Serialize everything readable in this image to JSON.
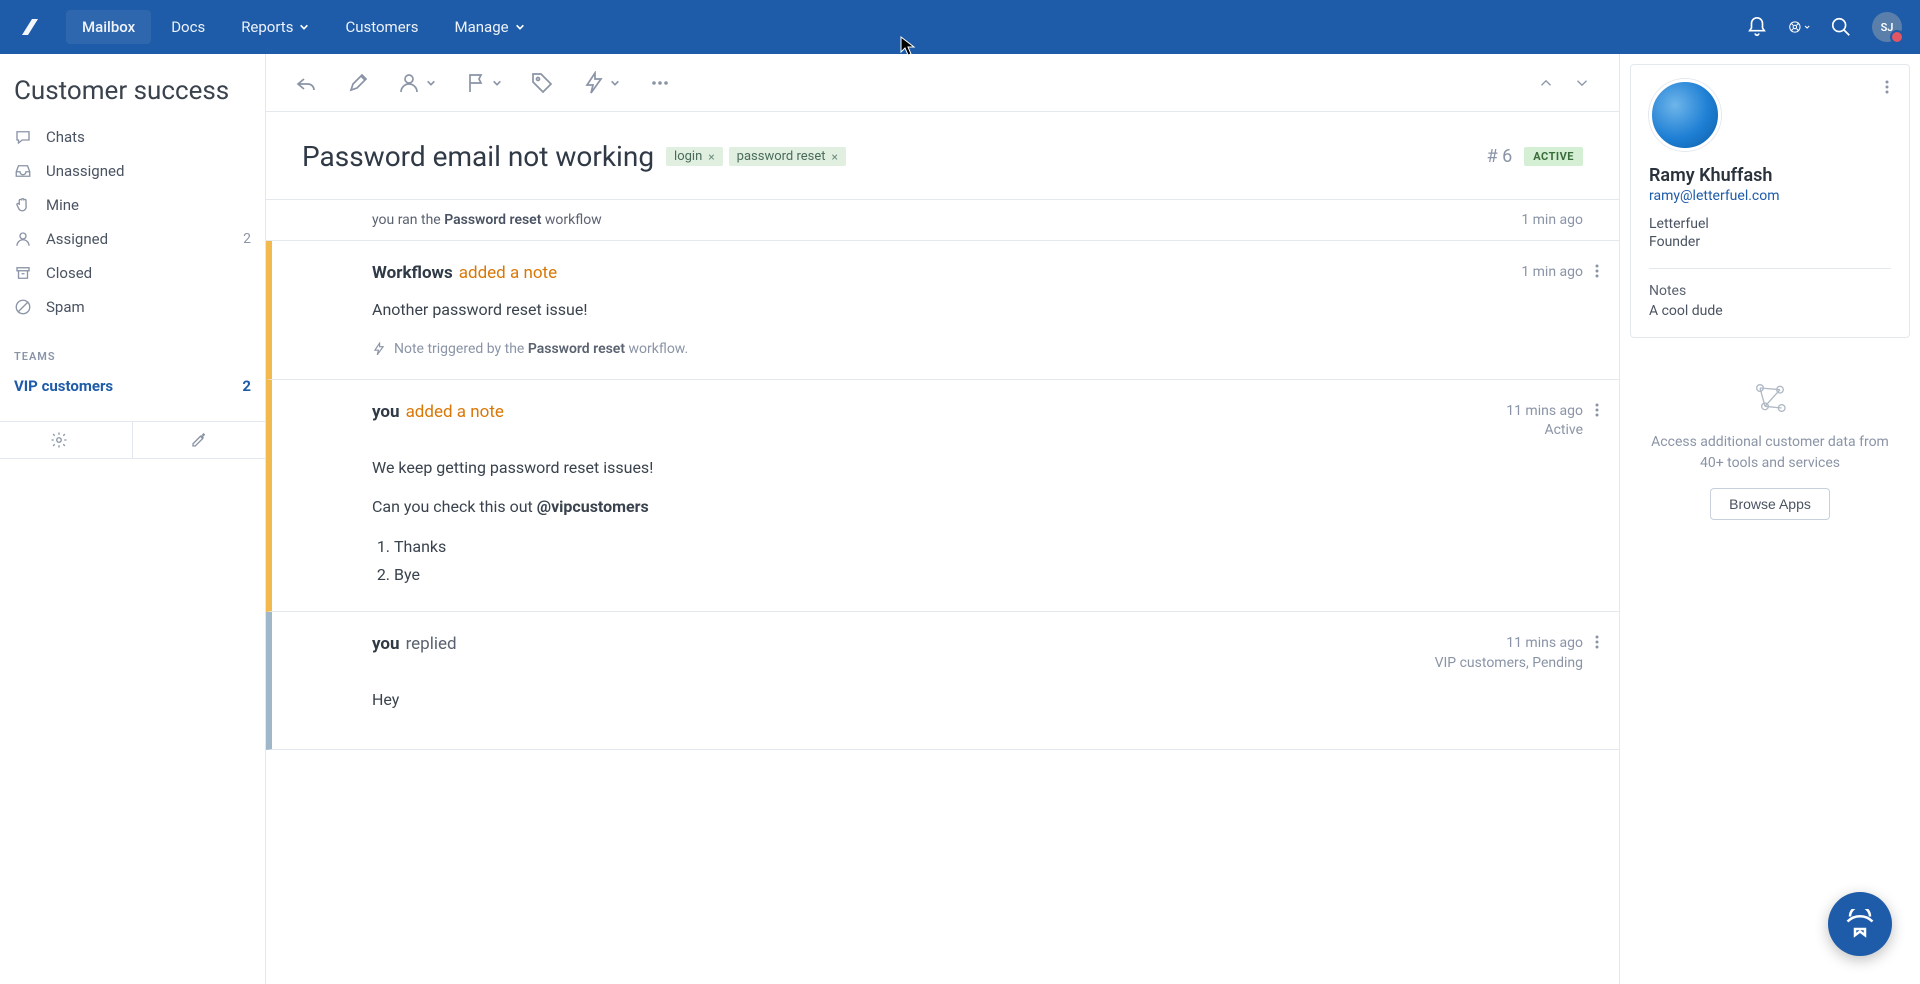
{
  "nav": {
    "mailbox": "Mailbox",
    "docs": "Docs",
    "reports": "Reports",
    "customers": "Customers",
    "manage": "Manage"
  },
  "avatar_initials": "SJ",
  "sidebar": {
    "title": "Customer success",
    "teams_heading": "TEAMS",
    "folders": {
      "chats": "Chats",
      "unassigned": "Unassigned",
      "mine": "Mine",
      "assigned": "Assigned",
      "assigned_count": "2",
      "closed": "Closed",
      "spam": "Spam"
    },
    "team": {
      "name": "VIP customers",
      "count": "2"
    }
  },
  "conversation": {
    "subject": "Password email not working",
    "tags": [
      "login",
      "password reset"
    ],
    "number": "# 6",
    "status": "ACTIVE",
    "event": {
      "prefix": "you ran the ",
      "bold": "Password reset",
      "suffix": " workflow",
      "time": "1 min ago"
    },
    "notes": [
      {
        "author": "Workflows",
        "action": "added a note",
        "time": "1 min ago",
        "status": "",
        "body": "Another password reset issue!",
        "trigger_prefix": "Note triggered by the ",
        "trigger_bold": "Password reset",
        "trigger_suffix": " workflow."
      },
      {
        "author": "you",
        "action": "added a note",
        "time": "11 mins ago",
        "status": "Active",
        "line1": "We keep getting password reset issues!",
        "line2_prefix": "Can you check this out ",
        "line2_mention": "@vipcustomers",
        "list1": "Thanks",
        "list2": "Bye"
      }
    ],
    "reply": {
      "author": "you",
      "action": "replied",
      "time": "11 mins ago",
      "status": "VIP customers, Pending",
      "body": "Hey"
    }
  },
  "details": {
    "name": "Ramy Khuffash",
    "email": "ramy@letterfuel.com",
    "company": "Letterfuel",
    "title": "Founder",
    "notes_label": "Notes",
    "notes_value": "A cool dude",
    "apps_text": "Access additional customer data from 40+ tools and services",
    "apps_btn": "Browse Apps"
  }
}
